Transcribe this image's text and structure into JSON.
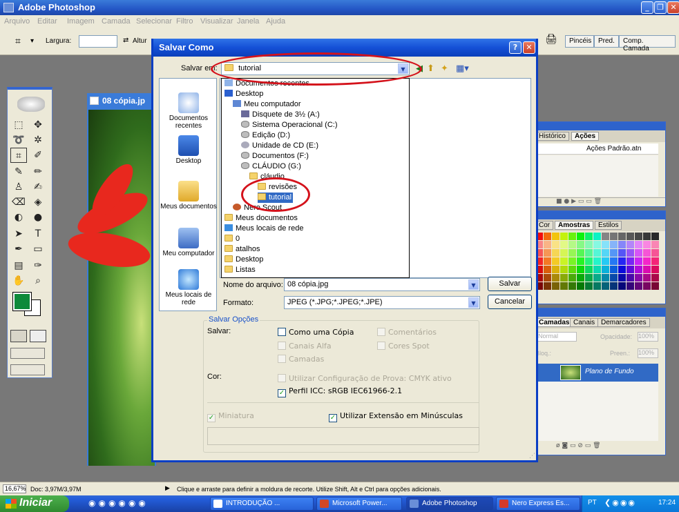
{
  "app": {
    "title": "Adobe Photoshop",
    "menu": [
      "Arquivo",
      "Editar",
      "Imagem",
      "Camada",
      "Selecionar",
      "Filtro",
      "Visualizar",
      "Janela",
      "Ajuda"
    ]
  },
  "options": {
    "width_label": "Largura:",
    "height_label": "Altur",
    "tabs": [
      "Pincéis",
      "Pred.",
      "Comp. Camada"
    ]
  },
  "document": {
    "title": "08 cópia.jp"
  },
  "dialog": {
    "title": "Salvar Como",
    "save_in_label": "Salvar em:",
    "save_in_value": "tutorial",
    "places": [
      "Documentos recentes",
      "Desktop",
      "Meus documentos",
      "Meu computador",
      "Meus locais de rede"
    ],
    "dropdown": [
      "Documentos recentes",
      "Desktop",
      "Meu computador",
      "Disquete de 3½ (A:)",
      "Sistema Operacional (C:)",
      "Edição (D:)",
      "Unidade de CD (E:)",
      "Documentos (F:)",
      "CLÁUDIO (G:)",
      "cláudio",
      "revisões",
      "tutorial",
      "Nero Scout",
      "Meus documentos",
      "Meus locais de rede",
      "0",
      "atalhos",
      "Desktop",
      "Listas"
    ],
    "filename_label": "Nome do arquivo:",
    "filename_value": "08 cópia.jpg",
    "format_label": "Formato:",
    "format_value": "JPEG (*.JPG;*.JPEG;*.JPE)",
    "save_button": "Salvar",
    "cancel_button": "Cancelar",
    "options_title": "Salvar Opções",
    "save_label": "Salvar:",
    "as_copy": "Como uma Cópia",
    "comments": "Comentários",
    "alpha": "Canais Alfa",
    "spot": "Cores Spot",
    "layers": "Camadas",
    "color_label": "Cor:",
    "proof": "Utilizar Configuração de Prova: CMYK ativo",
    "icc": "Perfil ICC: sRGB IEC61966-2.1",
    "thumbnail": "Miniatura",
    "lowercase": "Utilizar Extensão em Minúsculas"
  },
  "history_panel": {
    "tabs": [
      "Histórico",
      "Ações"
    ],
    "item": "Ações Padrão.atn"
  },
  "swatches_panel": {
    "tabs": [
      "Cor",
      "Amostras",
      "Estilos"
    ]
  },
  "layers_panel": {
    "tabs": [
      "Camadas",
      "Canais",
      "Demarcadores"
    ],
    "blend": "Normal",
    "opacity_label": "Opacidade:",
    "opacity": "100%",
    "lock_label": "Bloq.:",
    "fill_label": "Preen.:",
    "fill": "100%",
    "layer": "Plano de Fundo"
  },
  "status": {
    "zoom": "16,67%",
    "doc": "Doc: 3,97M/3,97M",
    "hint": "Clique e arraste para definir a moldura de recorte. Utilize Shift, Alt e Ctrl para opções adicionais."
  },
  "taskbar": {
    "start": "Iniciar",
    "tasks": [
      "INTRODUÇÃO ...",
      "Microsoft Power...",
      "Adobe Photoshop",
      "Nero Express Es..."
    ],
    "lang": "PT",
    "clock": "17:24"
  },
  "colors": {
    "title_blue": "#2456c6",
    "foreground": "#0e8a3a",
    "highlight": "#316ac5",
    "ring": "#d4121b"
  }
}
